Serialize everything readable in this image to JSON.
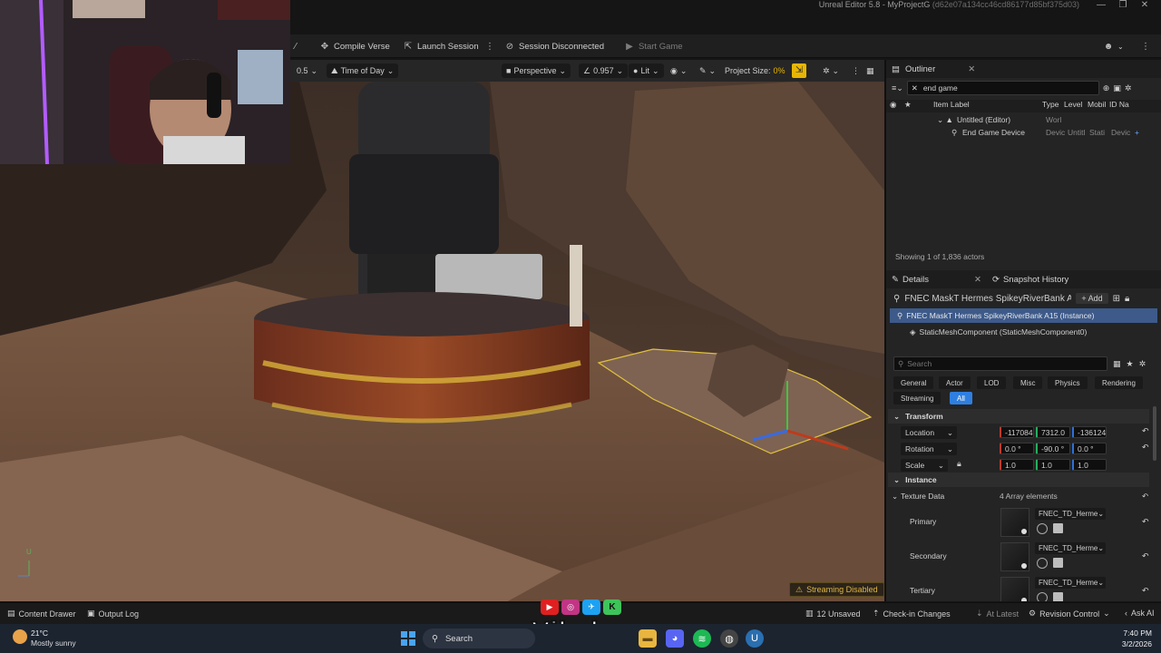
{
  "titlebar": {
    "title": "Unreal Editor 5.8 - MyProjectG",
    "hash": "(d62e07a134cc46cd86177d85bf375d03)",
    "minimize": "—",
    "restore": "❐",
    "close": "✕"
  },
  "toolbar": {
    "compile": "Compile Verse",
    "launch": "Launch Session",
    "session": "Session Disconnected",
    "start": "Start Game"
  },
  "viewport_bar": {
    "speed": "0.5",
    "time_of_day": "Time of Day",
    "perspective": "Perspective",
    "fov": "0.957",
    "lit": "Lit",
    "project_size_label": "Project Size:",
    "project_size_value": "0%"
  },
  "viewport": {
    "streaming": "Streaming Disabled",
    "axis_u": "U"
  },
  "webcam": {
    "overlay_icon": "camera-feed"
  },
  "outliner": {
    "tab": "Outliner",
    "search_value": "end game",
    "columns": {
      "label": "Item Label",
      "type": "Type",
      "level": "Level",
      "mobility": "Mobil",
      "id": "ID Na"
    },
    "rows": [
      {
        "label": "Untitled (Editor)",
        "type": "Worl",
        "level": "",
        "mobility": "",
        "id": ""
      },
      {
        "label": "End Game Device",
        "type": "Devic",
        "level": "Untitl",
        "mobility": "Stati",
        "id": "Devic"
      }
    ],
    "footer": "Showing 1 of 1,836 actors"
  },
  "details": {
    "tab": "Details",
    "tab2": "Snapshot History",
    "object_name": "FNEC MaskT Hermes SpikeyRiverBank A",
    "add": "Add",
    "instance": "FNEC MaskT Hermes SpikeyRiverBank A15 (Instance)",
    "component": "StaticMeshComponent (StaticMeshComponent0)",
    "search_placeholder": "Search",
    "filters": [
      "General",
      "Actor",
      "LOD",
      "Misc",
      "Physics",
      "Rendering",
      "Streaming",
      "All"
    ],
    "transform_section": "Transform",
    "location": {
      "label": "Location",
      "x": "-117084",
      "y": "7312.0",
      "z": "-136124"
    },
    "rotation": {
      "label": "Rotation",
      "x": "0.0 °",
      "y": "-90.0 °",
      "z": "0.0 °"
    },
    "scale": {
      "label": "Scale",
      "x": "1.0",
      "y": "1.0",
      "z": "1.0"
    },
    "instance_section": "Instance",
    "texture_data": {
      "label": "Texture Data",
      "count": "4 Array elements"
    },
    "textures": [
      {
        "slot": "Primary",
        "asset": "FNEC_TD_Herme"
      },
      {
        "slot": "Secondary",
        "asset": "FNEC_TD_Herme"
      },
      {
        "slot": "Tertiary",
        "asset": "FNEC_TD_Herme"
      }
    ]
  },
  "bottombar": {
    "content_drawer": "Content Drawer",
    "output_log": "Output Log",
    "unsaved": "12 Unsaved",
    "checkin": "Check-in Changes",
    "latest": "At Latest",
    "revision": "Revision Control",
    "ask_ai": "Ask AI"
  },
  "taskbar": {
    "weather_temp": "21°C",
    "weather_text": "Mostly sunny",
    "search": "Search",
    "watermark": "Vibzlo",
    "time": "7:40 PM",
    "date": "3/2/2026"
  },
  "colors": {
    "accent_yellow": "#e8b600",
    "selection_blue": "#3d5a8a",
    "all_tab_blue": "#2f7fe0"
  }
}
